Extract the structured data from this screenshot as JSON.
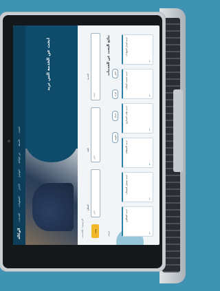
{
  "brand": {
    "logo_text": "الوكالة"
  },
  "nav": {
    "items": [
      "الخدمات",
      "المعلومات",
      "الأخبار",
      "التواصل",
      "عن الوكالة",
      "الأسئلة",
      "البحث"
    ]
  },
  "hero": {
    "title": "ابحث عن الخدمة التي تريد"
  },
  "breadcrumb": "الرئيسية / الخدمات",
  "search": {
    "button_label": "بحث",
    "fields": [
      {
        "label": "القطاع",
        "placeholder": "اختر"
      },
      {
        "label": "الفئة",
        "placeholder": "اختر"
      },
      {
        "label": "الخدمة",
        "placeholder": "ابحث"
      }
    ]
  },
  "results": {
    "title": "نتائج البحث عن الخدمات",
    "sort_label": "ترتيب"
  },
  "filters": [
    "الكل",
    "أفراد",
    "أعمال",
    "حكومة"
  ],
  "cards": [
    {
      "text": "خدمة إصدار الشهادات"
    },
    {
      "text": "خدمة تحديث البيانات"
    },
    {
      "text": "خدمة طلب التصاريح"
    },
    {
      "text": "خدمة الاستعلام"
    },
    {
      "text": "خدمة تسجيل المنشآت"
    },
    {
      "text": "خدمة الشكاوى"
    }
  ]
}
